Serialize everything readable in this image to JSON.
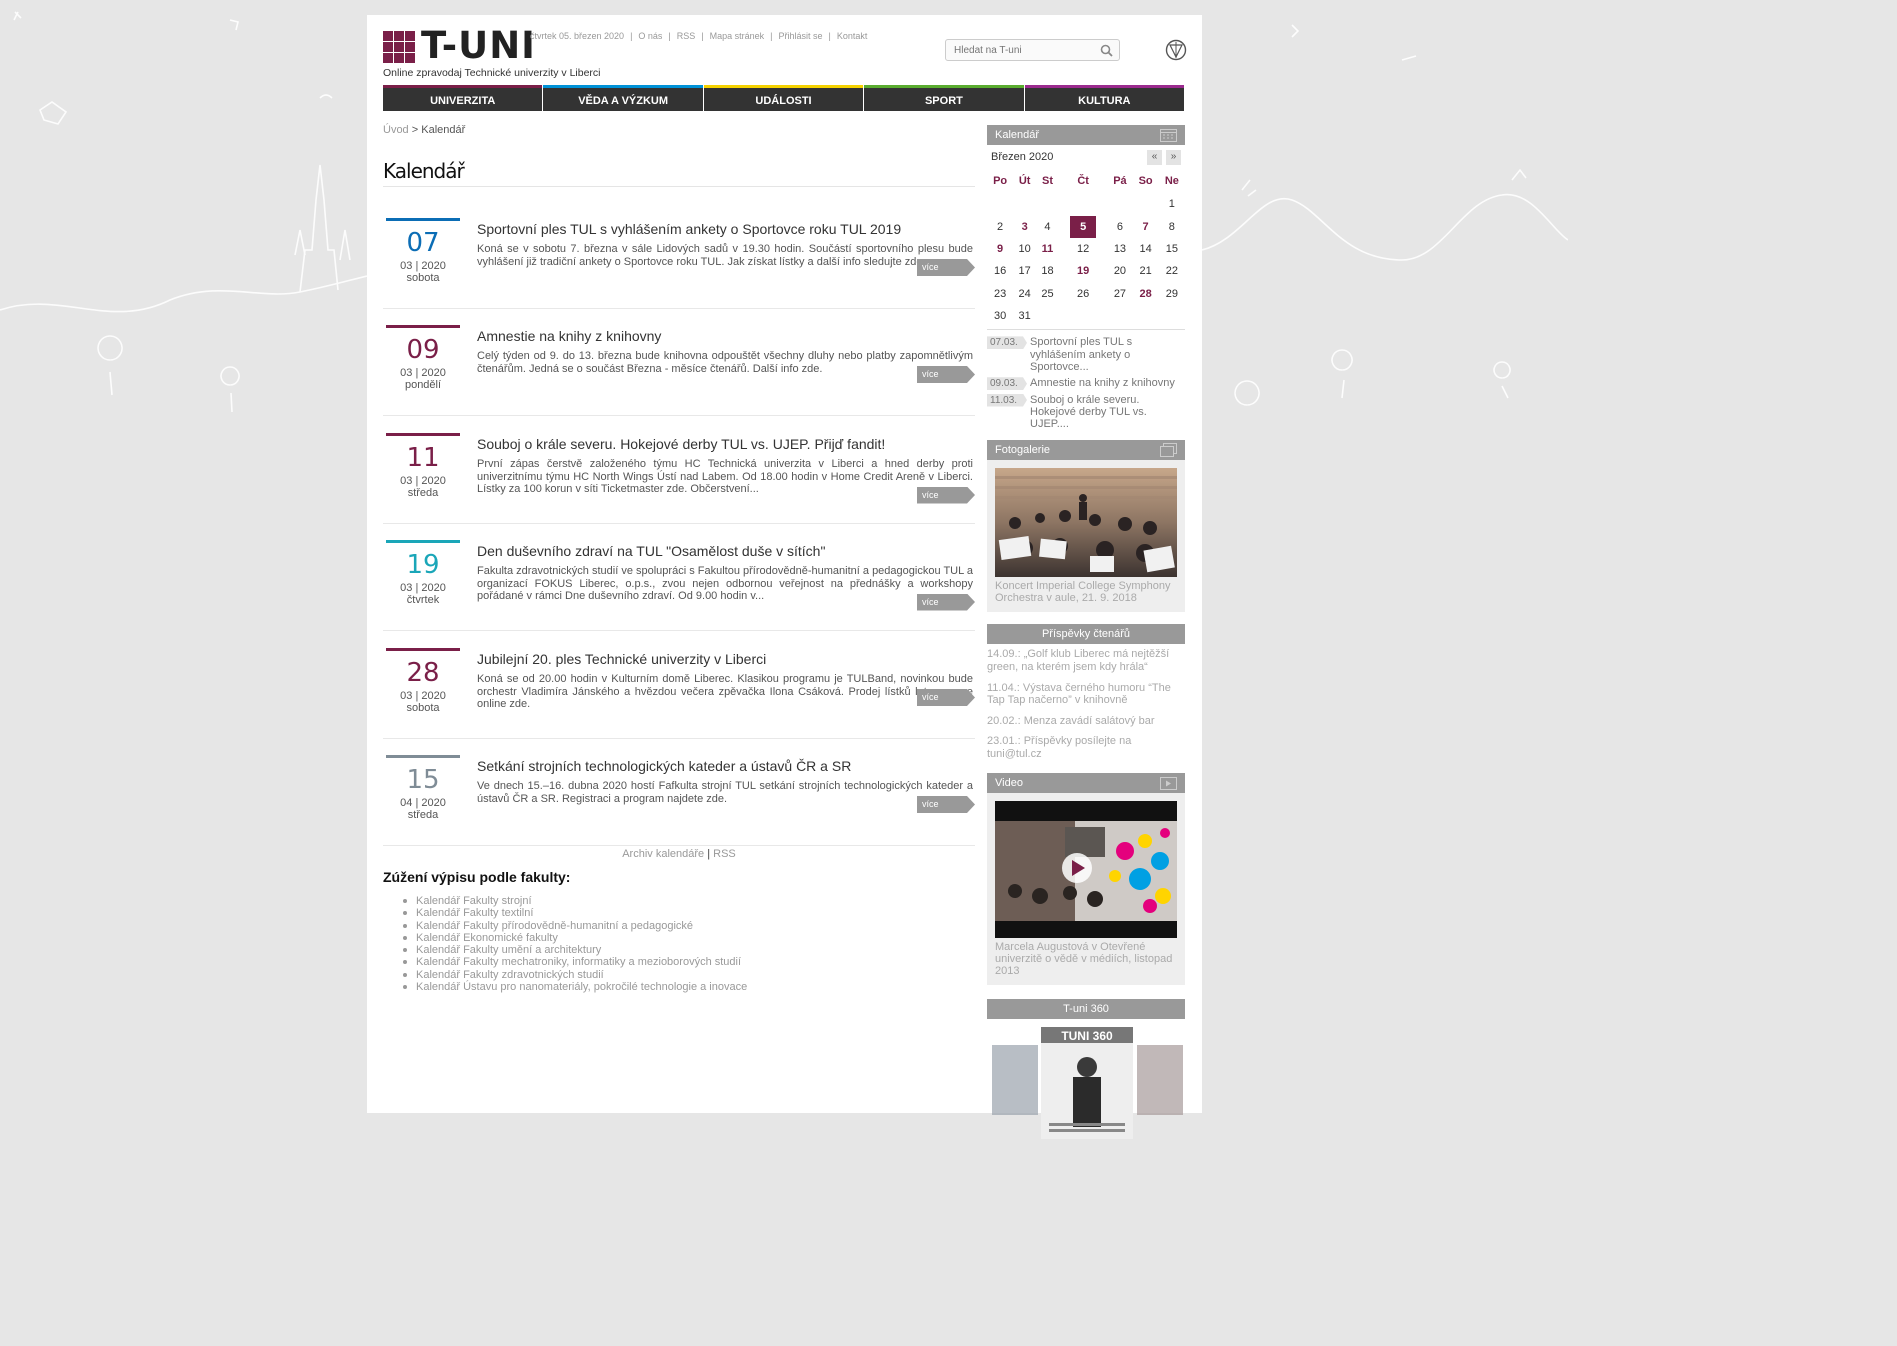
{
  "header": {
    "logo_text": "T-UNI",
    "logo_subtitle": "Online zpravodaj Technické univerzity v Liberci",
    "date": "čtvrtek 05. březen 2020",
    "links": [
      "O nás",
      "RSS",
      "Mapa stránek",
      "Přihlásit se",
      "Kontakt"
    ],
    "search_placeholder": "Hledat na T-uni"
  },
  "nav": [
    {
      "label": "UNIVERZITA",
      "color": "#7a1f48"
    },
    {
      "label": "VĚDA A VÝZKUM",
      "color": "#0092d8"
    },
    {
      "label": "UDÁLOSTI",
      "color": "#f5d200"
    },
    {
      "label": "SPORT",
      "color": "#5aac2f"
    },
    {
      "label": "KULTURA",
      "color": "#9a2a8e"
    }
  ],
  "breadcrumb": {
    "home": "Úvod",
    "sep": ">",
    "current": "Kalendář"
  },
  "page_title": "Kalendář",
  "more_label": "více",
  "events": [
    {
      "day": "07",
      "month_year": "03 | 2020",
      "weekday": "sobota",
      "color": "#0b6db5",
      "title": "Sportovní ples TUL s vyhlášením ankety o Sportovce roku TUL 2019",
      "text": "Koná se v sobotu 7. března v sále Lidových sadů v 19.30 hodin. Součástí sportovního plesu bude vyhlášení již tradiční ankety o Sportovce roku TUL. Jak získat lístky a další info sledujte zde."
    },
    {
      "day": "09",
      "month_year": "03 | 2020",
      "weekday": "pondělí",
      "color": "#7a1f48",
      "title": "Amnestie na knihy z knihovny",
      "text": "Celý týden od 9. do 13. března bude knihovna odpouštět všechny dluhy nebo platby zapomnětlivým čtenářům. Jedná se o součást Března - měsíce čtenářů. Další info zde."
    },
    {
      "day": "11",
      "month_year": "03 | 2020",
      "weekday": "středa",
      "color": "#7a1f48",
      "title": "Souboj o krále severu. Hokejové derby TUL vs. UJEP. Přijď fandit!",
      "text": "První zápas čerstvě založeného týmu HC Technická univerzita v Liberci a hned derby proti univerzitnímu týmu HC North Wings Ústí nad Labem. Od 18.00 hodin v Home Credit Areně v Liberci. Lístky za 100 korun v síti Ticketmaster zde. Občerstvení..."
    },
    {
      "day": "19",
      "month_year": "03 | 2020",
      "weekday": "čtvrtek",
      "color": "#1aa6b8",
      "title": "Den duševního zdraví na TUL \"Osamělost duše v sítích\"",
      "text": "Fakulta zdravotnických studií ve spolupráci s Fakultou přírodovědně-humanitní a pedagogickou TUL a organizací FOKUS Liberec, o.p.s., zvou nejen odbornou veřejnost na přednášky a workshopy pořádané v rámci Dne duševního zdraví. Od 9.00 hodin v..."
    },
    {
      "day": "28",
      "month_year": "03 | 2020",
      "weekday": "sobota",
      "color": "#7a1f48",
      "title": "Jubilejní 20. ples Technické univerzity v Liberci",
      "text": "Koná se od 20.00 hodin v Kulturním domě Liberec. Klasikou programu je TULBand, novinkou bude orchestr Vladimíra Jánského a hvězdou večera zpěvačka Ilona Csáková. Prodej lístků letos pouze online zde."
    },
    {
      "day": "15",
      "month_year": "04 | 2020",
      "weekday": "středa",
      "color": "#7f8c96",
      "title": "Setkání strojních technologických kateder a ústavů ČR a SR",
      "text": "Ve dnech 15.–16. dubna 2020 hostí Fafkulta strojní TUL setkání strojních technologických kateder a ústavů ČR a SR. Registraci a program najdete zde."
    }
  ],
  "archive": {
    "label": "Archiv kalendáře",
    "sep": "|",
    "rss": "RSS"
  },
  "filter": {
    "title": "Zúžení výpisu podle fakulty:",
    "items": [
      "Kalendář Fakulty strojní",
      "Kalendář Fakulty textilní",
      "Kalendář Fakulty přírodovědně-humanitní a pedagogické",
      "Kalendář Ekonomické fakulty",
      "Kalendář Fakulty umění a architektury",
      "Kalendář Fakulty mechatroniky, informatiky a mezioborových studií",
      "Kalendář Fakulty zdravotnických studií",
      "Kalendář Ústavu pro nanomateriály, pokročilé technologie a inovace"
    ]
  },
  "sidebar": {
    "calendar": {
      "title": "Kalendář",
      "month": "Březen 2020",
      "prev": "«",
      "next": "»",
      "weekdays": [
        "Po",
        "Út",
        "St",
        "Čt",
        "Pá",
        "So",
        "Ne"
      ],
      "weeks": [
        [
          "",
          "",
          "",
          "",
          "",
          "",
          "1"
        ],
        [
          "2",
          "3",
          "4",
          "5",
          "6",
          "7",
          "8"
        ],
        [
          "9",
          "10",
          "11",
          "12",
          "13",
          "14",
          "15"
        ],
        [
          "16",
          "17",
          "18",
          "19",
          "20",
          "21",
          "22"
        ],
        [
          "23",
          "24",
          "25",
          "26",
          "27",
          "28",
          "29"
        ],
        [
          "30",
          "31",
          "",
          "",
          "",
          "",
          ""
        ]
      ],
      "event_days": [
        "3",
        "7",
        "9",
        "11",
        "19",
        "28"
      ],
      "today": "5",
      "upcoming": [
        {
          "date": "07.03.",
          "text": "Sportovní ples TUL s vyhlášením ankety o Sportovce..."
        },
        {
          "date": "09.03.",
          "text": "Amnestie na knihy z knihovny"
        },
        {
          "date": "11.03.",
          "text": "Souboj o krále severu. Hokejové derby TUL vs. UJEP...."
        }
      ]
    },
    "gallery": {
      "title": "Fotogalerie",
      "caption": "Koncert Imperial College Symphony Orchestra v aule, 21. 9. 2018"
    },
    "readers": {
      "title": "Příspěvky čtenářů",
      "items": [
        "14.09.: „Golf klub Liberec má nejtěžší green, na kterém jsem kdy hrála“",
        "11.04.: Výstava černého humoru “The Tap Tap načerno” v knihovně",
        "20.02.: Menza zavádí salátový bar",
        "23.01.: Příspěvky posílejte na tuni@tul.cz"
      ]
    },
    "video": {
      "title": "Video",
      "caption": "Marcela Augustová v Otevřené univerzitě o vědě v médiích, listopad 2013"
    },
    "t360": {
      "title": "T-uni 360",
      "cover_text": "TUNI 360"
    }
  }
}
